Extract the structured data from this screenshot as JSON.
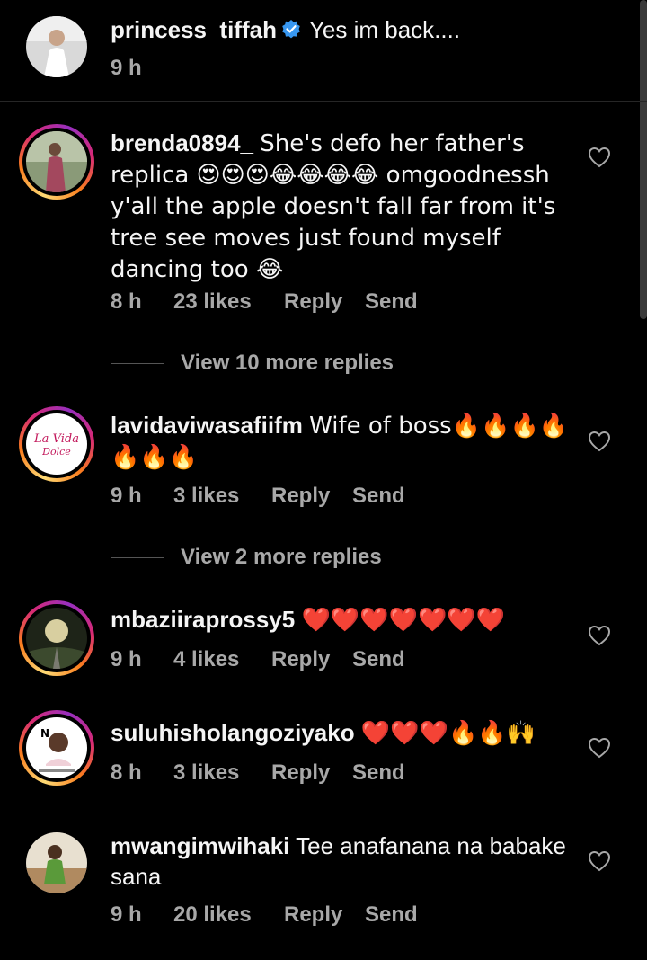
{
  "caption": {
    "username": "princess_tiffah",
    "text": "Yes im back....",
    "time": "9 h"
  },
  "comments": [
    {
      "username": "brenda0894_",
      "text": "She's defo her father's replica 😍😍😍😂😂😂😂 omgoodnessh y'all the apple doesn't fall far from it's tree see moves just found myself dancing too 😂",
      "time": "8 h",
      "likes": "23 likes",
      "reply": "Reply",
      "send": "Send",
      "view_more": "View 10 more replies"
    },
    {
      "username": "lavidaviwasafiifm",
      "text": "Wife of boss🔥🔥🔥🔥🔥🔥🔥",
      "time": "9 h",
      "likes": "3 likes",
      "reply": "Reply",
      "send": "Send",
      "view_more": "View 2 more replies"
    },
    {
      "username": "mbaziiraprossy5",
      "text": "❤️❤️❤️❤️❤️❤️❤️",
      "time": "9 h",
      "likes": "4 likes",
      "reply": "Reply",
      "send": "Send"
    },
    {
      "username": "suluhisholangoziyako",
      "text": "❤️❤️❤️🔥🔥🙌",
      "time": "8 h",
      "likes": "3 likes",
      "reply": "Reply",
      "send": "Send"
    },
    {
      "username": "mwangimwihaki",
      "text": "Tee  anafanana na babake sana",
      "time": "9 h",
      "likes": "20 likes",
      "reply": "Reply",
      "send": "Send"
    }
  ],
  "colors": {
    "background": "#000000",
    "text_primary": "#f5f5f5",
    "text_secondary": "#a8a8a8",
    "verified_badge": "#3897f0"
  },
  "icons": {
    "verified": "verified-badge-icon",
    "like": "heart-outline-icon"
  }
}
